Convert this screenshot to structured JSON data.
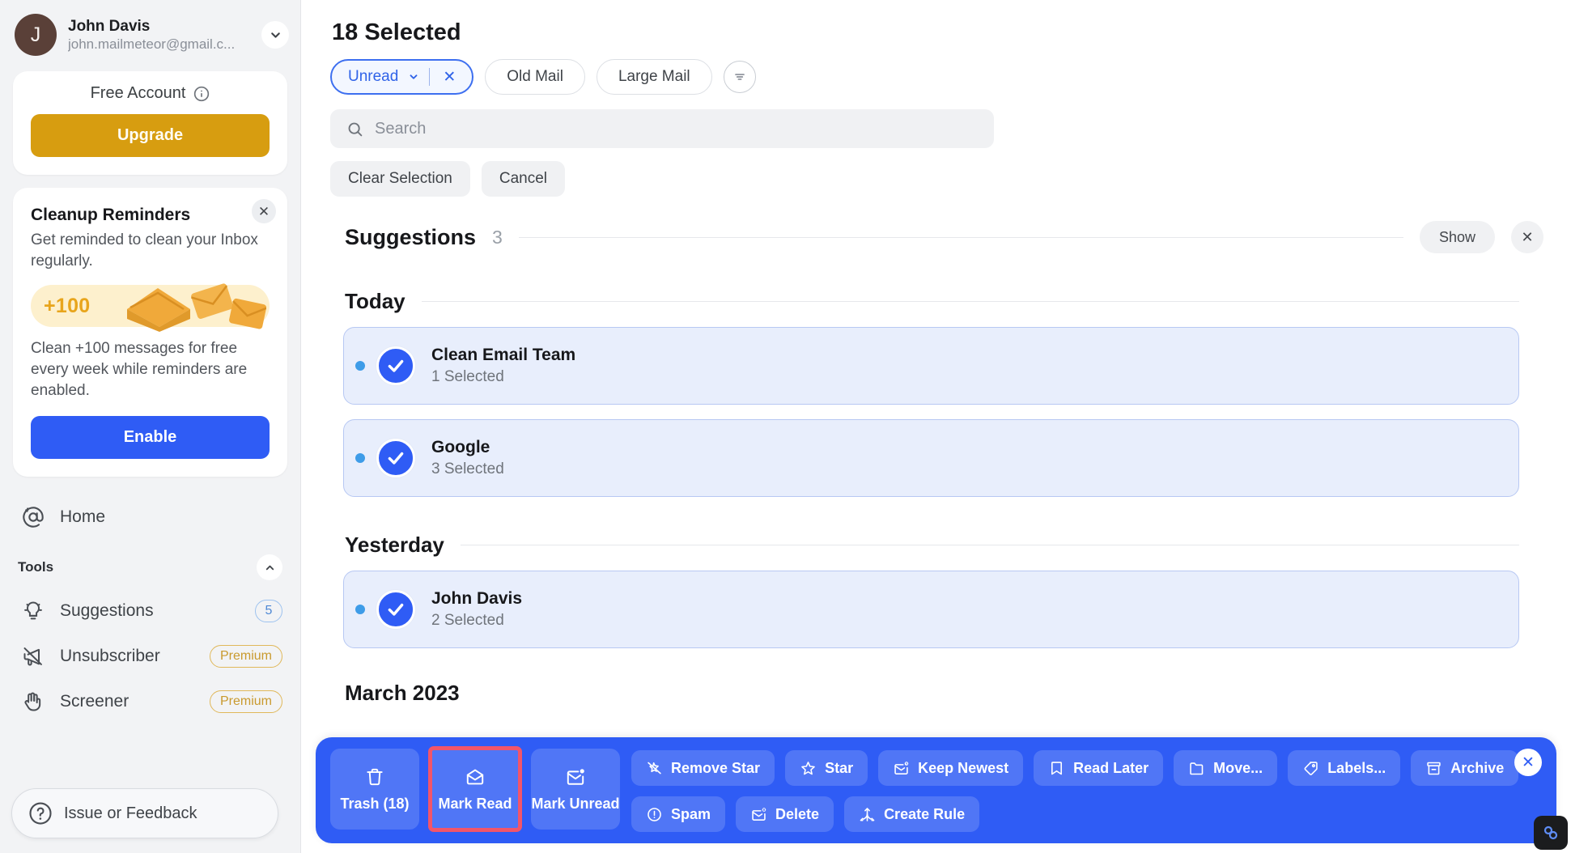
{
  "sidebar": {
    "account": {
      "avatar_initial": "J",
      "name": "John Davis",
      "email": "john.mailmeteor@gmail.c...",
      "chevron_icon": "chevron-down-icon"
    },
    "free_account": {
      "label": "Free Account",
      "info_icon": "info-icon",
      "upgrade_label": "Upgrade"
    },
    "cleanup_reminders": {
      "title": "Cleanup Reminders",
      "subtitle": "Get reminded to clean your Inbox regularly.",
      "promo_badge": "+100",
      "body": "Clean +100 messages for free every week while reminders are enabled.",
      "enable_label": "Enable",
      "close_icon": "close-icon"
    },
    "home": {
      "label": "Home",
      "icon": "at-sign-icon"
    },
    "tools": {
      "title": "Tools",
      "collapse_icon": "chevron-up-icon",
      "items": [
        {
          "label": "Suggestions",
          "icon": "lightbulb-icon",
          "badge": "5",
          "badge_type": "count"
        },
        {
          "label": "Unsubscriber",
          "icon": "megaphone-off-icon",
          "badge": "Premium",
          "badge_type": "premium"
        },
        {
          "label": "Screener",
          "icon": "hand-icon",
          "badge": "Premium",
          "badge_type": "premium"
        }
      ]
    },
    "feedback": {
      "label": "Issue or Feedback",
      "icon": "question-circle-icon"
    }
  },
  "main": {
    "selected_title": "18 Selected",
    "filters": [
      {
        "label": "Unread",
        "active": true,
        "has_dropdown": true,
        "has_clear": true
      },
      {
        "label": "Old Mail",
        "active": false,
        "has_dropdown": false,
        "has_clear": false
      },
      {
        "label": "Large Mail",
        "active": false,
        "has_dropdown": false,
        "has_clear": false
      }
    ],
    "filter_options_icon": "filter-lines-icon",
    "search": {
      "placeholder": "Search",
      "value": "",
      "icon": "search-icon"
    },
    "actions": [
      {
        "label": "Clear Selection"
      },
      {
        "label": "Cancel"
      }
    ],
    "suggestions_section": {
      "title": "Suggestions",
      "count": "3",
      "show_label": "Show",
      "close_icon": "close-icon"
    },
    "groups": [
      {
        "day": "Today",
        "rows": [
          {
            "sender": "Clean Email Team",
            "count": "1 Selected",
            "checked": true,
            "unread": true
          },
          {
            "sender": "Google",
            "count": "3 Selected",
            "checked": true,
            "unread": true
          }
        ]
      },
      {
        "day": "Yesterday",
        "rows": [
          {
            "sender": "John Davis",
            "count": "2 Selected",
            "checked": true,
            "unread": true
          }
        ]
      }
    ],
    "next_month_header": "March 2023"
  },
  "toolbar": {
    "primary": [
      {
        "label": "Trash (18)",
        "icon": "trash-icon",
        "highlighted": false
      },
      {
        "label": "Mark Read",
        "icon": "mail-open-icon",
        "highlighted": true
      },
      {
        "label": "Mark Unread",
        "icon": "mail-unread-icon",
        "highlighted": false
      }
    ],
    "chips_row1": [
      {
        "label": "Remove Star",
        "icon": "star-off-icon"
      },
      {
        "label": "Star",
        "icon": "star-icon"
      },
      {
        "label": "Keep Newest",
        "icon": "mail-clock-icon"
      },
      {
        "label": "Read Later",
        "icon": "bookmark-icon"
      },
      {
        "label": "Move...",
        "icon": "folder-icon"
      },
      {
        "label": "Labels...",
        "icon": "tag-icon"
      }
    ],
    "chips_row2": [
      {
        "label": "Archive",
        "icon": "archive-icon"
      },
      {
        "label": "Spam",
        "icon": "alert-circle-icon"
      },
      {
        "label": "Delete",
        "icon": "mail-x-icon"
      },
      {
        "label": "Create Rule",
        "icon": "rule-icon"
      }
    ],
    "close_icon": "close-icon",
    "accent_color": "#2f5cf5",
    "highlight_color": "#f2556a"
  },
  "corner_widget": {
    "icon": "link-chain-icon"
  }
}
